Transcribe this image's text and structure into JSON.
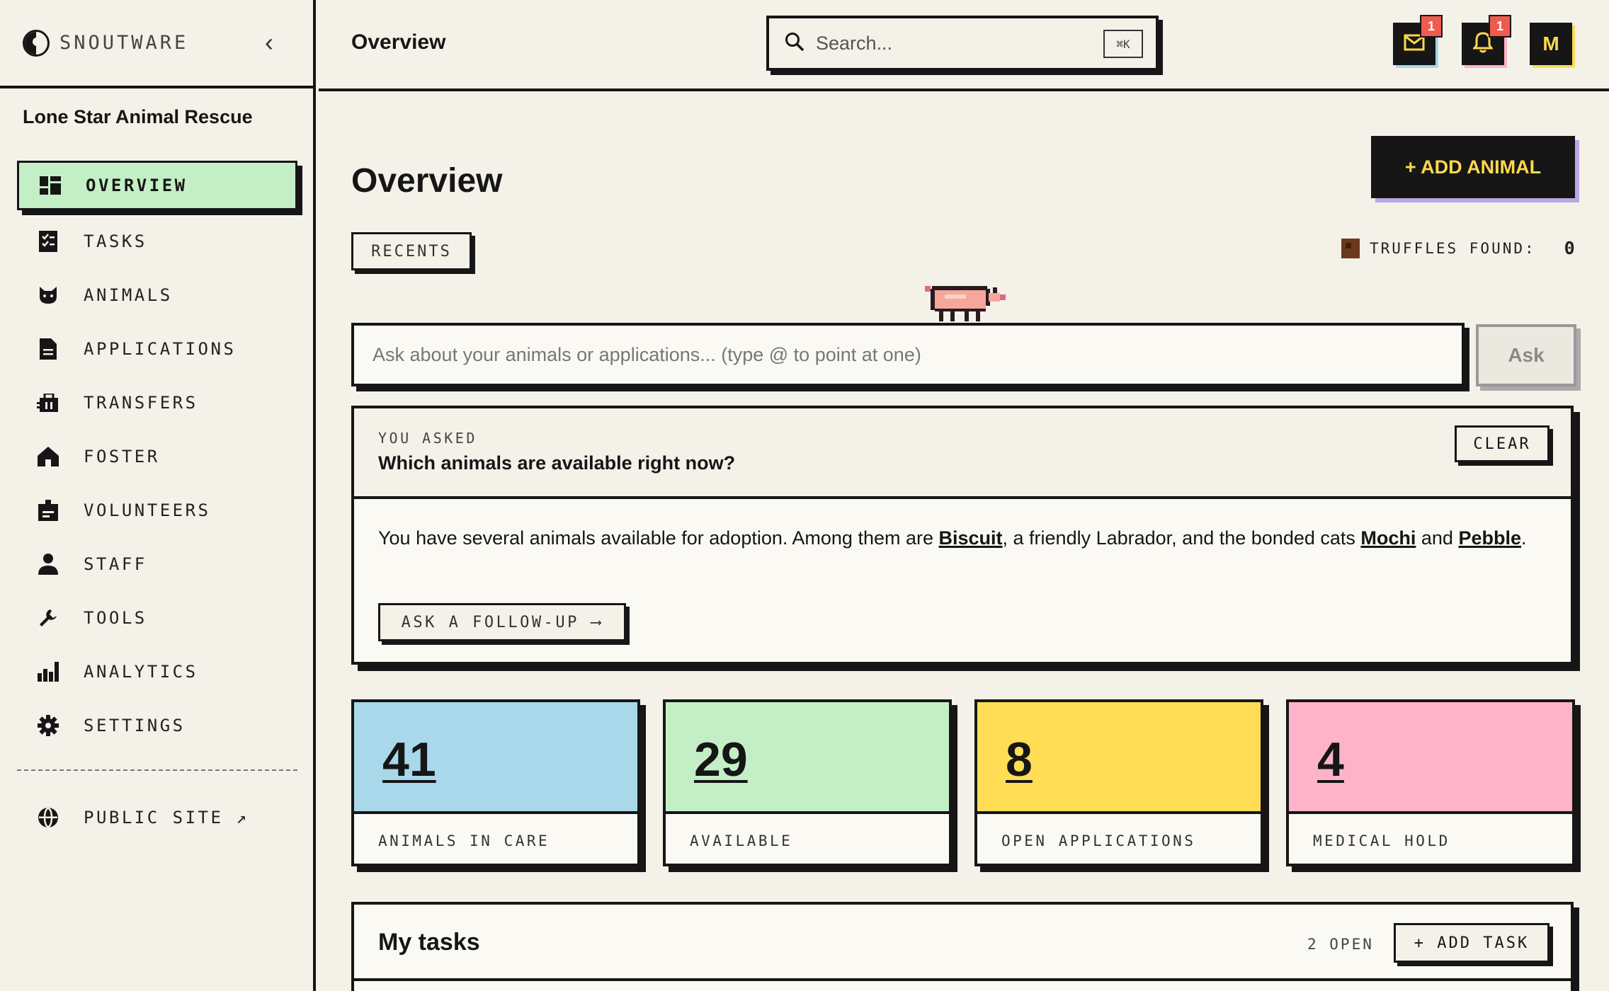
{
  "brand": {
    "name": "SNOUTWARE"
  },
  "org": {
    "name": "Lone Star Animal Rescue"
  },
  "nav": {
    "items": [
      {
        "label": "OVERVIEW",
        "icon": "dashboard-icon",
        "active": true
      },
      {
        "label": "TASKS",
        "icon": "checklist-icon"
      },
      {
        "label": "ANIMALS",
        "icon": "cat-icon"
      },
      {
        "label": "APPLICATIONS",
        "icon": "document-icon"
      },
      {
        "label": "TRANSFERS",
        "icon": "transfer-icon"
      },
      {
        "label": "FOSTER",
        "icon": "home-icon"
      },
      {
        "label": "VOLUNTEERS",
        "icon": "badge-icon"
      },
      {
        "label": "STAFF",
        "icon": "person-icon"
      },
      {
        "label": "TOOLS",
        "icon": "wrench-icon"
      },
      {
        "label": "ANALYTICS",
        "icon": "bar-chart-icon"
      },
      {
        "label": "SETTINGS",
        "icon": "gear-icon"
      }
    ],
    "public_site": "PUBLIC SITE ↗"
  },
  "header": {
    "title": "Overview",
    "search_placeholder": "Search...",
    "search_shortcut": "⌘K",
    "mail_badge": "1",
    "bell_badge": "1",
    "avatar_initial": "M"
  },
  "main": {
    "title": "Overview",
    "add_animal_label": "+ ADD ANIMAL",
    "recents_label": "RECENTS",
    "truffles_label": "TRUFFLES FOUND:",
    "truffles_count": "0",
    "ask_placeholder": "Ask about your animals or applications... (type @ to point at one)",
    "ask_button": "Ask"
  },
  "answer": {
    "kicker": "YOU ASKED",
    "question": "Which animals are available right now?",
    "clear_label": "CLEAR",
    "text_1": "You have several animals available for adoption. Among them are ",
    "link_1": "Biscuit",
    "text_2": ", a friendly Labrador, and the bonded cats ",
    "link_2": "Mochi",
    "text_3": " and ",
    "link_3": "Pebble",
    "text_4": ".",
    "followup_label": "ASK A FOLLOW-UP ⟶"
  },
  "stats": [
    {
      "value": "41",
      "label": "ANIMALS IN CARE",
      "color": "#a8d8ea"
    },
    {
      "value": "29",
      "label": "AVAILABLE",
      "color": "#c4efc6"
    },
    {
      "value": "8",
      "label": "OPEN APPLICATIONS",
      "color": "#ffdd55"
    },
    {
      "value": "4",
      "label": "MEDICAL HOLD",
      "color": "#ffb3c8"
    }
  ],
  "tasks": {
    "title": "My tasks",
    "open_count": "2 OPEN",
    "add_label": "+ ADD TASK"
  },
  "colors": {
    "background": "#f4f1e9",
    "ink": "#161616",
    "accent_yellow": "#ffd84d",
    "active_green": "#c4efc6",
    "badge_red": "#f05a4f"
  }
}
